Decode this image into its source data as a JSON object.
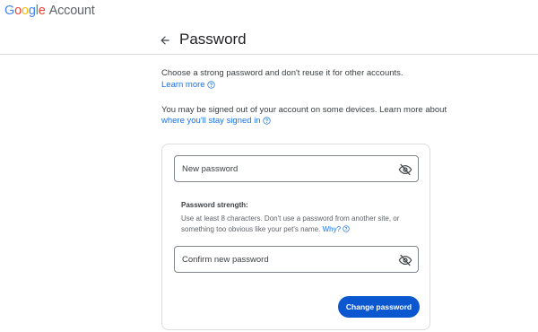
{
  "brand": {
    "logo_letters": [
      {
        "char": "G",
        "color": "#4285F4"
      },
      {
        "char": "o",
        "color": "#EA4335"
      },
      {
        "char": "o",
        "color": "#FBBC05"
      },
      {
        "char": "g",
        "color": "#4285F4"
      },
      {
        "char": "l",
        "color": "#34A853"
      },
      {
        "char": "e",
        "color": "#EA4335"
      }
    ],
    "account_label": "Account"
  },
  "header": {
    "title": "Password",
    "back_icon": "arrow-left-icon"
  },
  "intro": {
    "line1": "Choose a strong password and don't reuse it for other accounts.",
    "learn_more": "Learn more",
    "line2": "You may be signed out of your account on some devices. Learn more about",
    "stay_signed_in_link": "where you'll stay signed in"
  },
  "form": {
    "new_password_label": "New password",
    "confirm_password_label": "Confirm new password",
    "visibility_icon": "eye-off-icon",
    "strength_title": "Password strength:",
    "strength_text": "Use at least 8 characters. Don't use a password from another site, or something too obvious like your pet's name.",
    "why_link": "Why?",
    "submit_label": "Change password"
  },
  "colors": {
    "primary_button": "#0b57d0",
    "link": "#1a73e8"
  }
}
